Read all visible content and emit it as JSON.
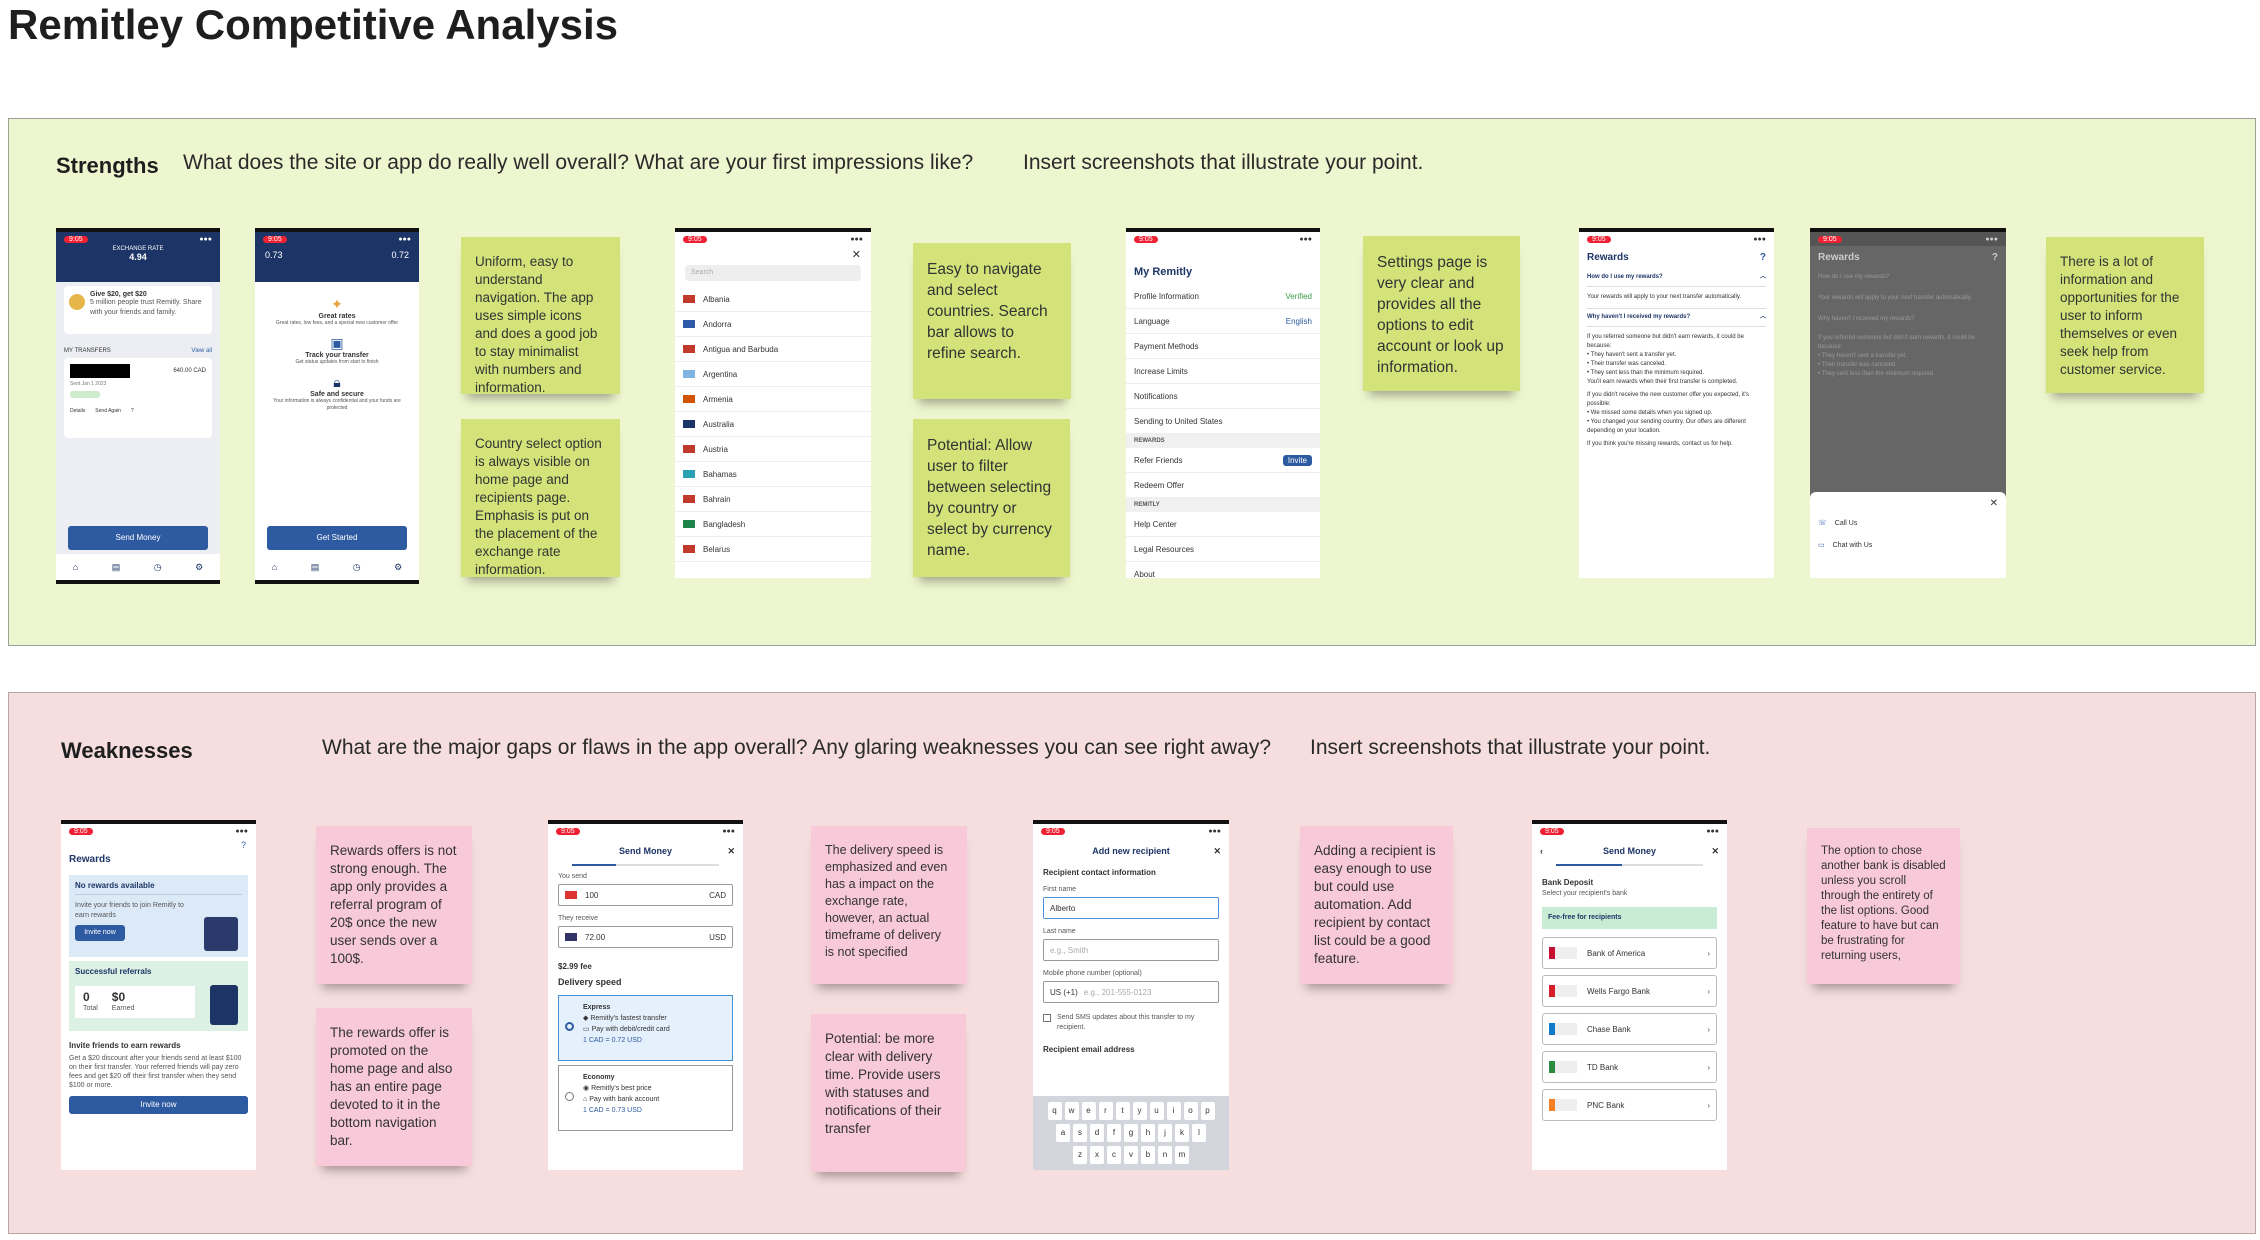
{
  "title": "Remitley Competitive Analysis",
  "strengths": {
    "label": "Strengths",
    "prompt1": "What does the site or app do really well overall? What are your first impressions like?",
    "prompt2": "Insert screenshots that illustrate your point.",
    "notes": [
      "Uniform, easy to understand navigation. The app uses simple icons and does a good job to stay minimalist with numbers and information.",
      "Country select option is always visible on home page and recipients page. Emphasis is put on the placement of the exchange rate information.",
      "Easy to navigate and select countries. Search bar allows to refine search.",
      "Potential: Allow user to filter between selecting by country or select by currency name.",
      "Settings page is very clear and provides all the options to edit account or look up information.",
      "There is a lot of information and opportunities for the user to inform themselves or even seek help from customer service."
    ]
  },
  "weaknesses": {
    "label": "Weaknesses",
    "prompt1": "What are the major gaps or flaws in the app overall? Any glaring weaknesses you can see right away?",
    "prompt2": "Insert screenshots that illustrate your point.",
    "notes": [
      "Rewards offers is not strong enough. The app only provides a referral program of 20$ once the new user sends over a 100$.",
      "The rewards offer is promoted on the home page and also has an entire page devoted to it in the bottom navigation bar.",
      "The delivery speed is emphasized and even has a impact on the exchange rate, however, an actual timeframe of delivery is not specified",
      "Potential: be more clear with delivery time. Provide users with statuses and notifications of their transfer",
      "Adding a recipient is easy enough to use but could use automation. Add recipient by contact list could be a good feature.",
      "The option to chose another bank is disabled unless you scroll through the entirety of the list options. Good feature to have but can be frustrating for returning users,"
    ]
  },
  "screens": {
    "time": "9:05",
    "home": {
      "exch": "EXCHANGE RATE",
      "rate": "4.94",
      "promo": "Give $20, get $20",
      "promo_sub": "5 million people trust Remitly. Share with your friends and family.",
      "transfers": "MY TRANSFERS",
      "view_all": "View all",
      "amount": "640.00 CAD",
      "date": "Sent Jan 1 2023",
      "details": "Details",
      "send_again": "Send Again",
      "send": "Send Money"
    },
    "onboard": {
      "l1": "Great rates",
      "d1": "Great rates, low fees, and a special new customer offer",
      "l2": "Track your transfer",
      "d2": "Get status updates from start to finish",
      "l3": "Safe and secure",
      "d3": "Your information is always confidential and your funds are protected",
      "cta": "Get Started",
      "left_rate": "0.73",
      "right_rate": "0.72"
    },
    "countries": {
      "search": "Search",
      "list": [
        "Albania",
        "Andorra",
        "Antigua and Barbuda",
        "Argentina",
        "Armenia",
        "Australia",
        "Austria",
        "Bahamas",
        "Bahrain",
        "Bangladesh",
        "Belarus"
      ]
    },
    "settings": {
      "title": "My Remitly",
      "rows": [
        "Profile Information",
        "Language",
        "Payment Methods",
        "Increase Limits",
        "Notifications",
        "Sending to United States"
      ],
      "verified": "Verified",
      "english": "English",
      "rewards_h": "REWARDS",
      "refer": "Refer Friends",
      "invite": "Invite",
      "redeem": "Redeem Offer",
      "remitly_h": "REMITLY",
      "help": "Help Center",
      "legal": "Legal Resources",
      "about": "About"
    },
    "rewards_faq": {
      "title": "Rewards",
      "q1": "How do I use my rewards?",
      "a1": "Your rewards will apply to your next transfer automatically.",
      "q2": "Why haven't I received my rewards?",
      "a2": "If you referred someone but didn't earn rewards, it could be because:",
      "b1": "They haven't sent a transfer yet.",
      "b2": "Their transfer was canceled.",
      "b3": "They sent less than the minimum required.",
      "a3": "You'll earn rewards when their first transfer is completed.",
      "a4": "If you didn't receive the new customer offer you expected, it's possible:",
      "b4": "We missed some details when you signed up.",
      "b5": "You changed your sending country. Our offers are different depending on your location.",
      "a5": "If you think you're missing rewards, contact us for help.",
      "call": "Call Us",
      "chat": "Chat with Us"
    },
    "rewards": {
      "title": "Rewards",
      "none": "No rewards available",
      "invite_txt": "Invite your friends to join Remitly to earn rewards",
      "invite_btn": "Invite now",
      "success": "Successful referrals",
      "zero": "0",
      "total": "Total",
      "dollars": "$0",
      "earned": "Earned",
      "earn_h": "Invite friends to earn rewards",
      "earn_d": "Get a $20 discount after your friends send at least $100 on their first transfer. Your referred friends will pay zero fees and get $20 off their first transfer when they send $100 or more.",
      "invite_btn2": "Invite now"
    },
    "send": {
      "title": "Send Money",
      "you_send": "You send",
      "amt": "100",
      "cad": "CAD",
      "they_receive": "They receive",
      "recv": "72.00",
      "usd": "USD",
      "fee": "$2.99 fee",
      "speed": "Delivery speed",
      "express": "Express",
      "e1": "Remitly's fastest transfer",
      "e2": "Pay with debit/credit card",
      "e3": "1 CAD = 0.72 USD",
      "economy": "Economy",
      "c1": "Remitly's best price",
      "c2": "Pay with bank account",
      "c3": "1 CAD = 0.73 USD"
    },
    "recipient": {
      "title": "Add new recipient",
      "h": "Recipient contact information",
      "first": "First name",
      "first_val": "Alberto",
      "last": "Last name",
      "last_ph": "e.g., Smith",
      "mobile": "Mobile phone number (optional)",
      "code": "US (+1)",
      "phone_ph": "e.g., 201-555-0123",
      "sms": "Send SMS updates about this transfer to my recipient.",
      "email_h": "Recipient email address",
      "keys1": [
        "q",
        "w",
        "e",
        "r",
        "t",
        "y",
        "u",
        "i",
        "o",
        "p"
      ],
      "keys2": [
        "a",
        "s",
        "d",
        "f",
        "g",
        "h",
        "j",
        "k",
        "l"
      ],
      "keys3": [
        "z",
        "x",
        "c",
        "v",
        "b",
        "n",
        "m"
      ]
    },
    "bank": {
      "title": "Send Money",
      "h": "Bank Deposit",
      "sub": "Select your recipient's bank",
      "fee": "Fee-free for recipients",
      "banks": [
        "Bank of America",
        "Wells Fargo Bank",
        "Chase Bank",
        "TD Bank",
        "PNC Bank"
      ]
    }
  },
  "colors": {
    "strengths_bg": "#eef6cf",
    "weaknesses_bg": "#f6dede",
    "sticky_yellow": "#d3e37a",
    "sticky_pink": "#f7c9d9",
    "navy": "#1d3566"
  }
}
